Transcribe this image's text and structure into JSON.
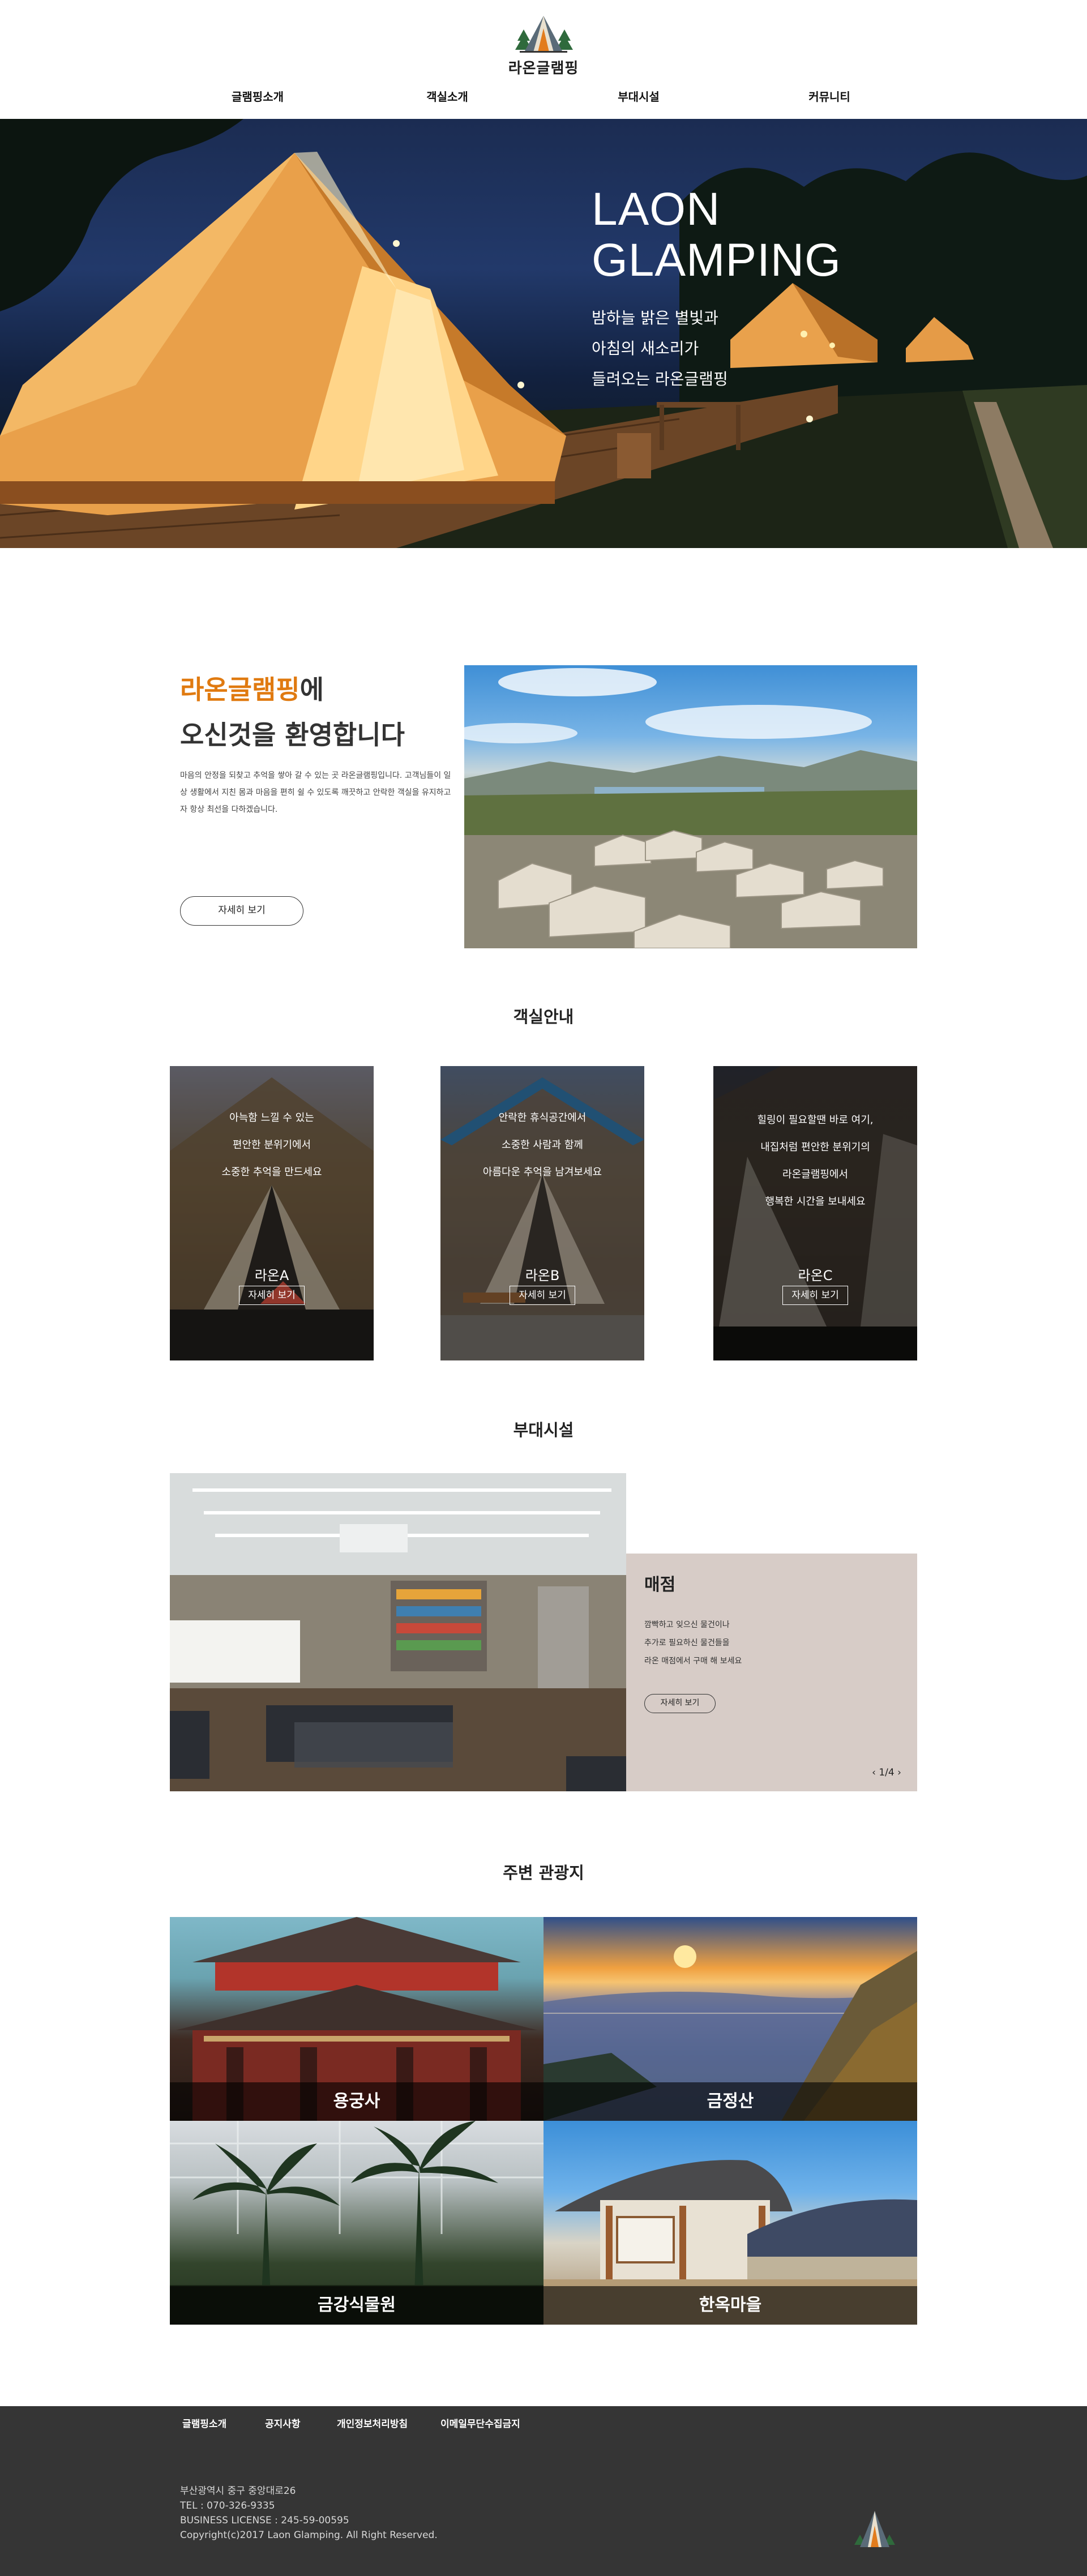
{
  "header": {
    "logo_text": "라온글램핑",
    "nav": [
      "글램핑소개",
      "객실소개",
      "부대시설",
      "커뮤니티"
    ]
  },
  "hero": {
    "title_line1": "LAON",
    "title_line2": "GLAMPING",
    "sub_line1": "밤하늘 밝은 별빛과",
    "sub_line2": "아침의 새소리가",
    "sub_line3": "들려오는 라온글램핑"
  },
  "welcome": {
    "title_accent": "라온글램핑",
    "title_suffix": "에",
    "title_line2": "오신것을 환영합니다",
    "desc": "마음의 안정을 되찾고 추억을 쌓아 갈 수 있는 곳 라온글램핑입니다. 고객님들이 일상 생활에서 지친 몸과 마음을 편히 쉴 수 있도록 깨끗하고 안락한 객실을 유지하고자 항상 최선을 다하겠습니다.",
    "button": "자세히 보기"
  },
  "rooms": {
    "title": "객실안내",
    "items": [
      {
        "lines": [
          "아늑함 느낄 수 있는",
          "편안한 분위기에서",
          "소중한 추억을 만드세요"
        ],
        "name": "라온A",
        "button": "자세히 보기"
      },
      {
        "lines": [
          "안락한 휴식공간에서",
          "소중한 사람과 함께",
          "아름다운 추억을 남겨보세요"
        ],
        "name": "라온B",
        "button": "자세히 보기"
      },
      {
        "lines": [
          "힐링이 필요할땐 바로 여기,",
          "내집처럼 편안한 분위기의",
          "라온글램핑에서",
          "행복한 시간을 보내세요"
        ],
        "name": "라온C",
        "button": "자세히 보기"
      }
    ]
  },
  "facility": {
    "title": "부대시설",
    "name": "매점",
    "desc_lines": [
      "깜빡하고 잊으신 물건이나",
      "추가로 필요하신 물건들을",
      "라온 매점에서 구매 해 보세요"
    ],
    "button": "자세히 보기",
    "pager": "1/4"
  },
  "attractions": {
    "title": "주변 관광지",
    "items": [
      "용궁사",
      "금정산",
      "금강식물원",
      "한옥마을"
    ]
  },
  "footer": {
    "nav": [
      "글램핑소개",
      "공지사항",
      "개인정보처리방침",
      "이메일무단수집금지"
    ],
    "address": "부산광역시 중구 중앙대로26",
    "tel": "TEL : 070-326-9335",
    "license": "BUSINESS LICENSE : 245-59-00595",
    "copyright": "Copyright(c)2017 Laon Glamping. All Right Reserved."
  }
}
